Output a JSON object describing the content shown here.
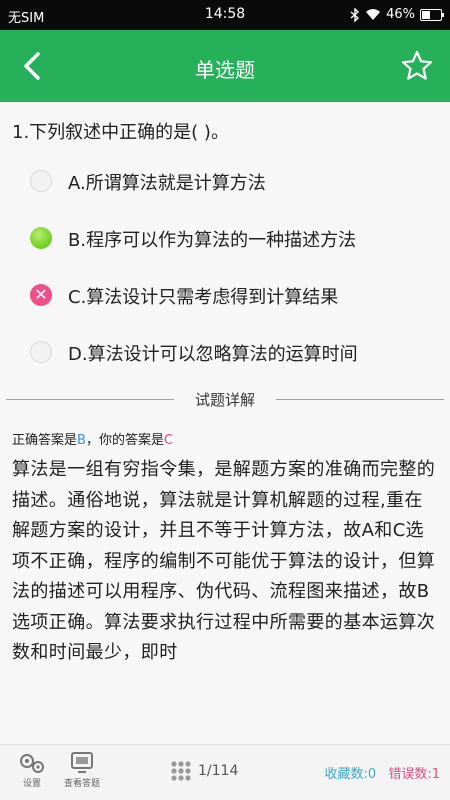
{
  "status_bar": {
    "carrier": "无SIM",
    "time": "14:58",
    "battery": "46%"
  },
  "header": {
    "title": "单选题",
    "back_icon": "chevron-left-icon",
    "favorite_icon": "star-outline-icon"
  },
  "question": {
    "text": "1.下列叙述中正确的是( )。",
    "options": [
      {
        "label": "A.所谓算法就是计算方法",
        "state": "none"
      },
      {
        "label": "B.程序可以作为算法的一种描述方法",
        "state": "correct"
      },
      {
        "label": "C.算法设计只需考虑得到计算结果",
        "state": "wrong"
      },
      {
        "label": "D.算法设计可以忽略算法的运算时间",
        "state": "none"
      }
    ]
  },
  "explanation": {
    "heading": "试题详解",
    "correct_prefix": "正确答案是",
    "correct_answer": "B",
    "your_prefix": "，你的答案是",
    "your_answer": "C",
    "body": "算法是一组有穷指令集，是解题方案的准确而完整的描述。通俗地说，算法就是计算机解题的过程,重在解题方案的设计，并且不等于计算方法，故A和C选项不正确，程序的编制不可能优于算法的设计，但算法的描述可以用程序、伪代码、流程图来描述，故B选项正确。算法要求执行过程中所需要的基本运算次数和时间最少，即时"
  },
  "bottom_bar": {
    "settings_label": "设置",
    "answer_sheet_label": "查看答题",
    "progress": "1/114",
    "favorites": "收藏数:0",
    "errors": "错误数:1"
  },
  "colors": {
    "header_green": "#27b05a",
    "correct_green": "#6ccc25",
    "wrong_pink": "#ef4e8a",
    "divider_cyan": "#48c3d6",
    "answer_blue": "#3a8fd8"
  }
}
